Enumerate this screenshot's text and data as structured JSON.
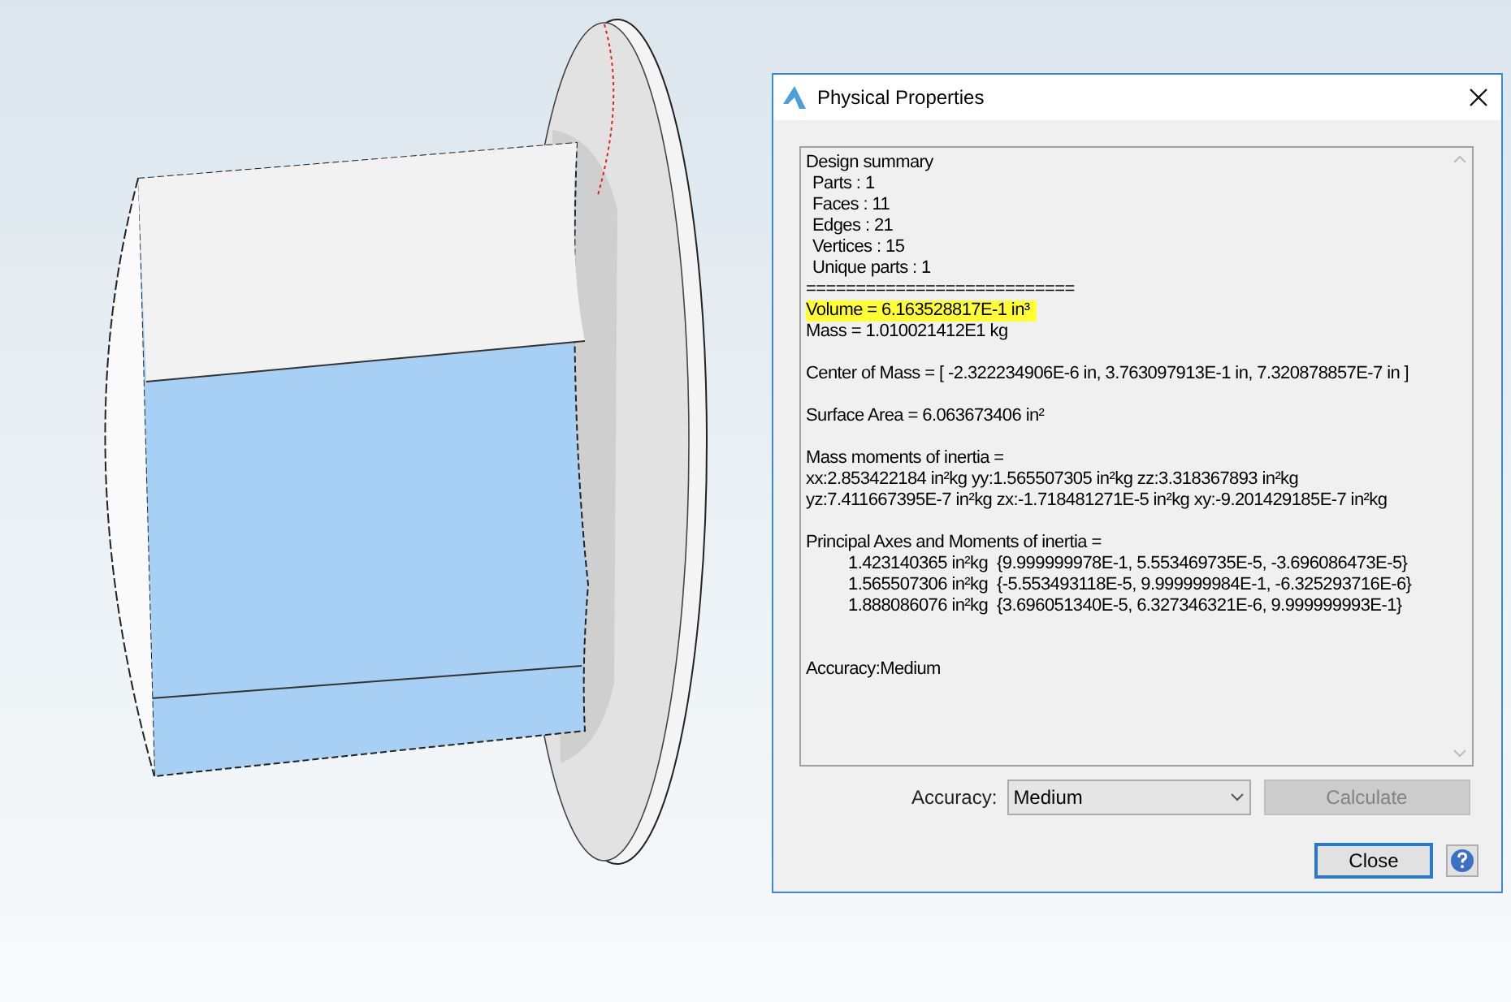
{
  "dialog": {
    "title": "Physical Properties",
    "report": [
      [
        {
          "text": "Design summary",
          "kind": "plain"
        },
        {
          "text": "Parts : 1",
          "kind": "sub"
        },
        {
          "text": "Faces : 11",
          "kind": "sub"
        },
        {
          "text": "Edges : 21",
          "kind": "sub"
        },
        {
          "text": "Vertices : 15",
          "kind": "sub"
        },
        {
          "text": "Unique parts : 1",
          "kind": "sub"
        },
        {
          "text": "===========================",
          "kind": "plain"
        },
        {
          "text": "Volume = 6.163528817E-1 in³",
          "kind": "highlight"
        },
        {
          "text": "Mass = 1.010021412E1 kg",
          "kind": "plain"
        }
      ],
      [
        {
          "text": "Center of Mass = [ -2.322234906E-6 in, 3.763097913E-1 in, 7.320878857E-7 in ]",
          "kind": "plain"
        }
      ],
      [
        {
          "text": "Surface Area = 6.063673406 in²",
          "kind": "plain"
        }
      ],
      [
        {
          "text": "Mass moments of inertia =",
          "kind": "plain"
        },
        {
          "text": "xx:2.853422184 in²kg yy:1.565507305 in²kg zz:3.318367893 in²kg",
          "kind": "plain"
        },
        {
          "text": "yz:7.411667395E-7 in²kg zx:-1.718481271E-5 in²kg xy:-9.201429185E-7 in²kg",
          "kind": "plain"
        }
      ],
      [
        {
          "text": "Principal Axes and Moments of inertia =",
          "kind": "plain"
        },
        {
          "text": "1.423140365 in²kg  {9.999999978E-1, 5.553469735E-5, -3.696086473E-5}",
          "kind": "indent"
        },
        {
          "text": "1.565507306 in²kg  {-5.553493118E-5, 9.999999984E-1, -6.325293716E-6}",
          "kind": "indent"
        },
        {
          "text": "1.888086076 in²kg  {3.696051340E-5, 6.327346321E-6, 9.999999993E-1}",
          "kind": "indent"
        }
      ],
      [
        {
          "text": "Accuracy:Medium",
          "kind": "plain"
        }
      ]
    ],
    "accuracy_label": "Accuracy:",
    "accuracy_value": "Medium",
    "calculate_button": {
      "label": "Calculate",
      "disabled": true
    },
    "close_button": {
      "label": "Close"
    }
  }
}
